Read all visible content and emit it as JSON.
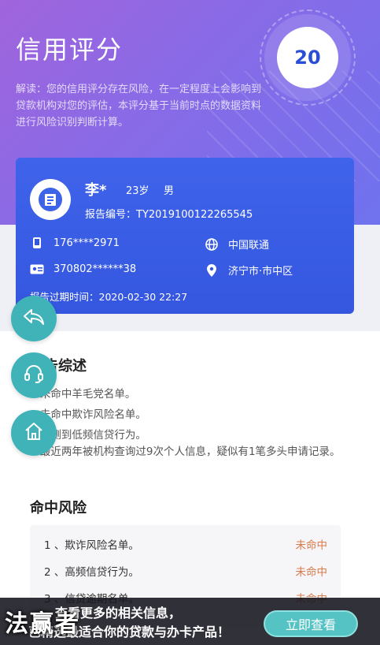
{
  "header": {
    "title": "信用评分",
    "score": "20",
    "description": "解读：您的信用评分存在风险，在一定程度上会影响到贷款机构对您的评估，本评分基于当前时点的数据资料进行风险识别判断计算。"
  },
  "profile": {
    "name": "李*",
    "age": "23岁",
    "gender": "男",
    "report_no": "报告编号：TY2019100122265545",
    "phone": "176****2971",
    "carrier": "中国联通",
    "id_number": "370802******38",
    "location": "济宁市·市中区",
    "expire": "报告过期时间：2020-02-30 22:27"
  },
  "summary": {
    "title": "报告综述",
    "items": [
      "1.未命中羊毛党名单。",
      "2.未命中欺诈风险名单。",
      "3.检测到低频信贷行为。",
      "4.最近两年被机构查询过9次个人信息，疑似有1笔多头申请记录。"
    ]
  },
  "risk": {
    "title": "命中风险",
    "rows": [
      {
        "label": "1 、欺诈风险名单。",
        "status": "未命中"
      },
      {
        "label": "2 、高频信贷行为。",
        "status": "未命中"
      },
      {
        "label": "3 、信贷逾期名单。",
        "status": "未命中"
      }
    ]
  },
  "banner": {
    "line1": "查看更多的相关信息，",
    "line2": "已精选最适合你的贷款与办卡产品！",
    "cta": "立即查看",
    "brand": "法赢者"
  },
  "icons": {
    "back": "back-arrow-icon",
    "support": "headset-icon",
    "home": "home-icon"
  },
  "colors": {
    "accent": "#3557e0",
    "teal": "#3fb3b8",
    "status": "#d97a4a"
  }
}
